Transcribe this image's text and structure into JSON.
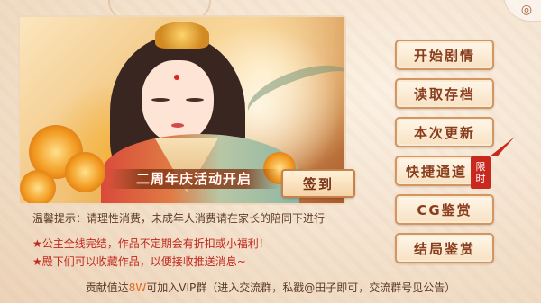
{
  "corner": {
    "icon": "swirl-icon"
  },
  "banner": {
    "caption": "二周年庆活动开启"
  },
  "signin": {
    "label": "签到"
  },
  "menu": [
    {
      "label": "开始剧情"
    },
    {
      "label": "读取存档"
    },
    {
      "label": "本次更新"
    },
    {
      "label": "快捷通道"
    },
    {
      "label": "CG鉴赏"
    },
    {
      "label": "结局鉴赏"
    }
  ],
  "badge": {
    "line1": "限",
    "line2": "时"
  },
  "tip": "温馨提示：请理性消费，未成年人消费请在家长的陪同下进行",
  "notices": [
    "★公主全线完结，作品不定期会有折扣或小福利！",
    "★殿下们可以收藏作品，以便接收推送消息~"
  ],
  "footer": {
    "before": "贡献值达",
    "highlight": "8W",
    "after": "可加入VIP群（进入交流群，私戳@田子即可，交流群号见公告）"
  },
  "colors": {
    "accent": "#c9281e",
    "button_text": "#8a3d1d",
    "border": "#d59561"
  }
}
